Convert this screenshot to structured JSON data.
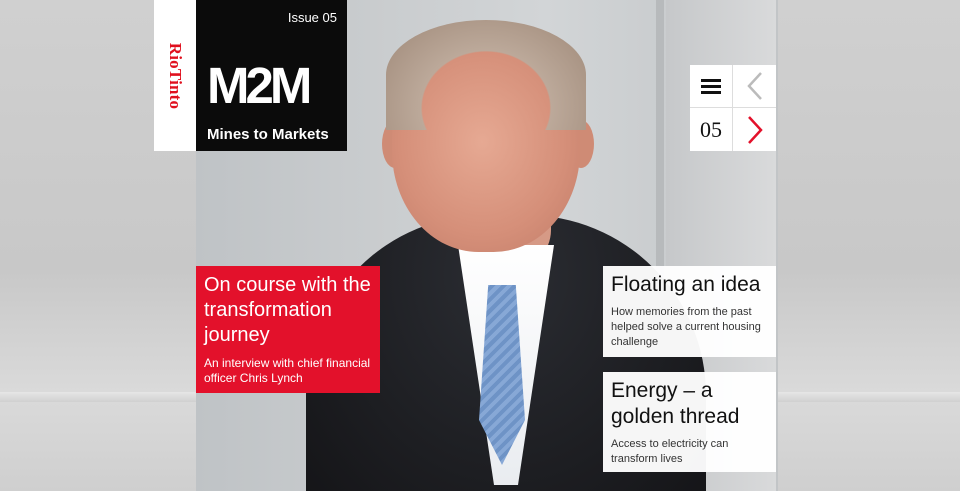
{
  "brand": {
    "company": "RioTinto",
    "masthead_logo": "M2M",
    "masthead_tagline": "Mines to Markets",
    "issue_label": "Issue 05"
  },
  "nav": {
    "menu_icon": "hamburger-menu-icon",
    "prev_icon": "chevron-left-icon",
    "next_icon": "chevron-right-icon",
    "current_issue": "05"
  },
  "features": {
    "lead": {
      "title": "On course with the transformation journey",
      "subtitle": "An interview with chief financial officer Chris Lynch"
    },
    "items": [
      {
        "title": "Floating an idea",
        "subtitle": "How memories from the past helped solve a current housing challenge"
      },
      {
        "title": "Energy – a golden thread",
        "subtitle": "Access to electricity can transform lives"
      }
    ]
  },
  "colors": {
    "accent_red": "#e3112b",
    "logo_red": "#e0101e",
    "masthead_black": "#0b0b0b",
    "nav_prev_disabled": "#bbbbbb"
  }
}
